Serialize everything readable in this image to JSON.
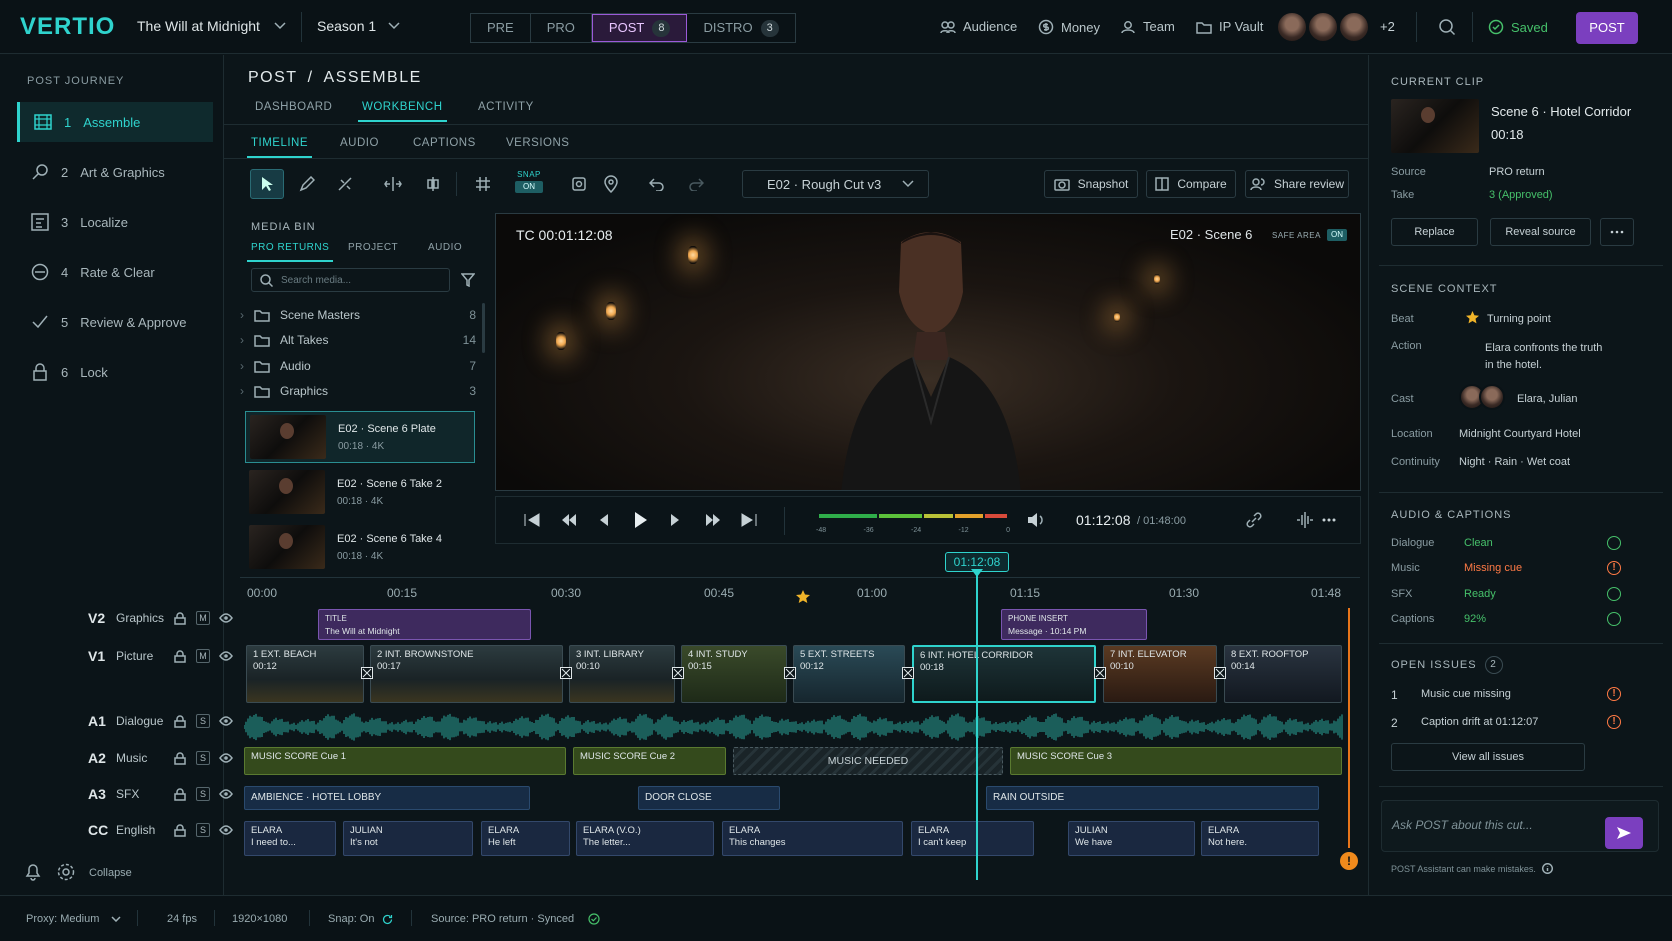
{
  "app": {
    "logo": "VERTIO",
    "project": "The Will at Midnight",
    "season": "Season 1"
  },
  "phases": [
    {
      "label": "PRE"
    },
    {
      "label": "PRO"
    },
    {
      "label": "POST",
      "count": "8"
    },
    {
      "label": "DISTRO",
      "count": "3"
    }
  ],
  "topnav": {
    "audience": "Audience",
    "money": "Money",
    "team": "Team",
    "ipvault": "IP Vault",
    "avatars_more": "+2",
    "saved": "Saved",
    "post_button": "POST"
  },
  "sidebar": {
    "title": "POST JOURNEY",
    "items": [
      {
        "num": "1",
        "label": "Assemble"
      },
      {
        "num": "2",
        "label": "Art & Graphics"
      },
      {
        "num": "3",
        "label": "Localize"
      },
      {
        "num": "4",
        "label": "Rate & Clear"
      },
      {
        "num": "5",
        "label": "Review & Approve"
      },
      {
        "num": "6",
        "label": "Lock"
      }
    ],
    "collapse": "Collapse"
  },
  "page": {
    "breadcrumb1": "POST",
    "sep": "/",
    "breadcrumb2": "ASSEMBLE",
    "tabs": [
      "DASHBOARD",
      "WORKBENCH",
      "ACTIVITY"
    ],
    "subtabs": [
      "TIMELINE",
      "AUDIO",
      "CAPTIONS",
      "VERSIONS"
    ]
  },
  "toolbar": {
    "snap_label": "SNAP",
    "snap_state": "ON",
    "version": "E02 · Rough Cut v3",
    "snapshot": "Snapshot",
    "compare": "Compare",
    "share": "Share review"
  },
  "bin": {
    "title": "MEDIA BIN",
    "tabs": [
      "PRO RETURNS",
      "PROJECT",
      "AUDIO"
    ],
    "search_placeholder": "Search media...",
    "folders": [
      {
        "name": "Scene Masters",
        "count": "8"
      },
      {
        "name": "Alt Takes",
        "count": "14"
      },
      {
        "name": "Audio",
        "count": "7"
      },
      {
        "name": "Graphics",
        "count": "3"
      }
    ],
    "clips": [
      {
        "name": "E02 · Scene 6 Plate",
        "meta": "00:18 · 4K"
      },
      {
        "name": "E02 · Scene 6 Take 2",
        "meta": "00:18 · 4K"
      },
      {
        "name": "E02 · Scene 6 Take 4",
        "meta": "00:18 · 4K"
      }
    ]
  },
  "viewer": {
    "tc": "TC  00:01:12:08",
    "scene": "E02 · Scene 6",
    "safe_label": "SAFE AREA",
    "safe_state": "ON"
  },
  "transport": {
    "meter_ticks": [
      "-48",
      "-36",
      "-24",
      "-12",
      "0"
    ],
    "current": "01:12:08",
    "total": "/ 01:48:00"
  },
  "timeline": {
    "playhead": "01:12:08",
    "ruler": [
      "00:00",
      "00:15",
      "00:30",
      "00:45",
      "01:00",
      "01:15",
      "01:30",
      "01:48"
    ],
    "tracks": [
      {
        "id": "V2",
        "name": "Graphics",
        "mode": "M"
      },
      {
        "id": "V1",
        "name": "Picture",
        "mode": "M"
      },
      {
        "id": "A1",
        "name": "Dialogue",
        "mode": "S"
      },
      {
        "id": "A2",
        "name": "Music",
        "mode": "S"
      },
      {
        "id": "A3",
        "name": "SFX",
        "mode": "S"
      },
      {
        "id": "CC",
        "name": "English",
        "mode": "S"
      }
    ],
    "gfx": [
      {
        "t1": "TITLE",
        "t2": "The Will at Midnight"
      },
      {
        "t1": "PHONE INSERT",
        "t2": "Message · 10:14 PM"
      }
    ],
    "video": [
      {
        "t1": "1 EXT. BEACH",
        "t2": "00:12"
      },
      {
        "t1": "2 INT. BROWNSTONE",
        "t2": "00:17"
      },
      {
        "t1": "3 INT. LIBRARY",
        "t2": "00:10"
      },
      {
        "t1": "4 INT. STUDY",
        "t2": "00:15"
      },
      {
        "t1": "5 EXT. STREETS",
        "t2": "00:12"
      },
      {
        "t1": "6 INT. HOTEL CORRIDOR",
        "t2": "00:18"
      },
      {
        "t1": "7 INT. ELEVATOR",
        "t2": "00:10"
      },
      {
        "t1": "8 EXT. ROOFTOP",
        "t2": "00:14"
      }
    ],
    "music": [
      "MUSIC SCORE Cue 1",
      "MUSIC SCORE Cue 2",
      "MUSIC NEEDED",
      "MUSIC SCORE Cue 3"
    ],
    "sfx": [
      "AMBIENCE · HOTEL LOBBY",
      "DOOR CLOSE",
      "RAIN OUTSIDE"
    ],
    "captions": [
      {
        "t1": "ELARA",
        "t2": "I need to..."
      },
      {
        "t1": "JULIAN",
        "t2": "It's not"
      },
      {
        "t1": "ELARA",
        "t2": "He left"
      },
      {
        "t1": "ELARA (V.O.)",
        "t2": "The letter..."
      },
      {
        "t1": "ELARA",
        "t2": "This changes"
      },
      {
        "t1": "ELARA",
        "t2": "I can't keep"
      },
      {
        "t1": "JULIAN",
        "t2": "We have"
      },
      {
        "t1": "ELARA",
        "t2": "Not here."
      }
    ]
  },
  "right": {
    "current_title": "CURRENT CLIP",
    "clip_name": "Scene 6 · Hotel Corridor",
    "clip_dur": "00:18",
    "source_label": "Source",
    "source_val": "PRO return",
    "take_label": "Take",
    "take_val": "3 (Approved)",
    "replace": "Replace",
    "reveal": "Reveal source",
    "context_title": "SCENE CONTEXT",
    "beat_label": "Beat",
    "beat_val": "Turning point",
    "action_label": "Action",
    "action_val": "Elara confronts the truth in the hotel.",
    "cast_label": "Cast",
    "cast_val": "Elara, Julian",
    "location_label": "Location",
    "location_val": "Midnight Courtyard Hotel",
    "continuity_label": "Continuity",
    "continuity_val": "Night · Rain · Wet coat",
    "ac_title": "AUDIO & CAPTIONS",
    "ac": [
      {
        "label": "Dialogue",
        "val": "Clean",
        "color": "#46c06a"
      },
      {
        "label": "Music",
        "val": "Missing cue",
        "color": "#ff7a45"
      },
      {
        "label": "SFX",
        "val": "Ready",
        "color": "#46c06a"
      },
      {
        "label": "Captions",
        "val": "92%",
        "color": "#46c06a"
      }
    ],
    "issues_title": "OPEN ISSUES",
    "issues_count": "2",
    "issues": [
      {
        "num": "1",
        "text": "Music cue missing"
      },
      {
        "num": "2",
        "text": "Caption drift at 01:12:07"
      }
    ],
    "view_all": "View all issues",
    "ask_placeholder": "Ask POST about this cut...",
    "disclaimer": "POST Assistant can make mistakes."
  },
  "status": {
    "proxy": "Proxy: Medium",
    "fps": "24 fps",
    "res": "1920×1080",
    "snap": "Snap: On",
    "source": "Source: PRO return · Synced"
  }
}
